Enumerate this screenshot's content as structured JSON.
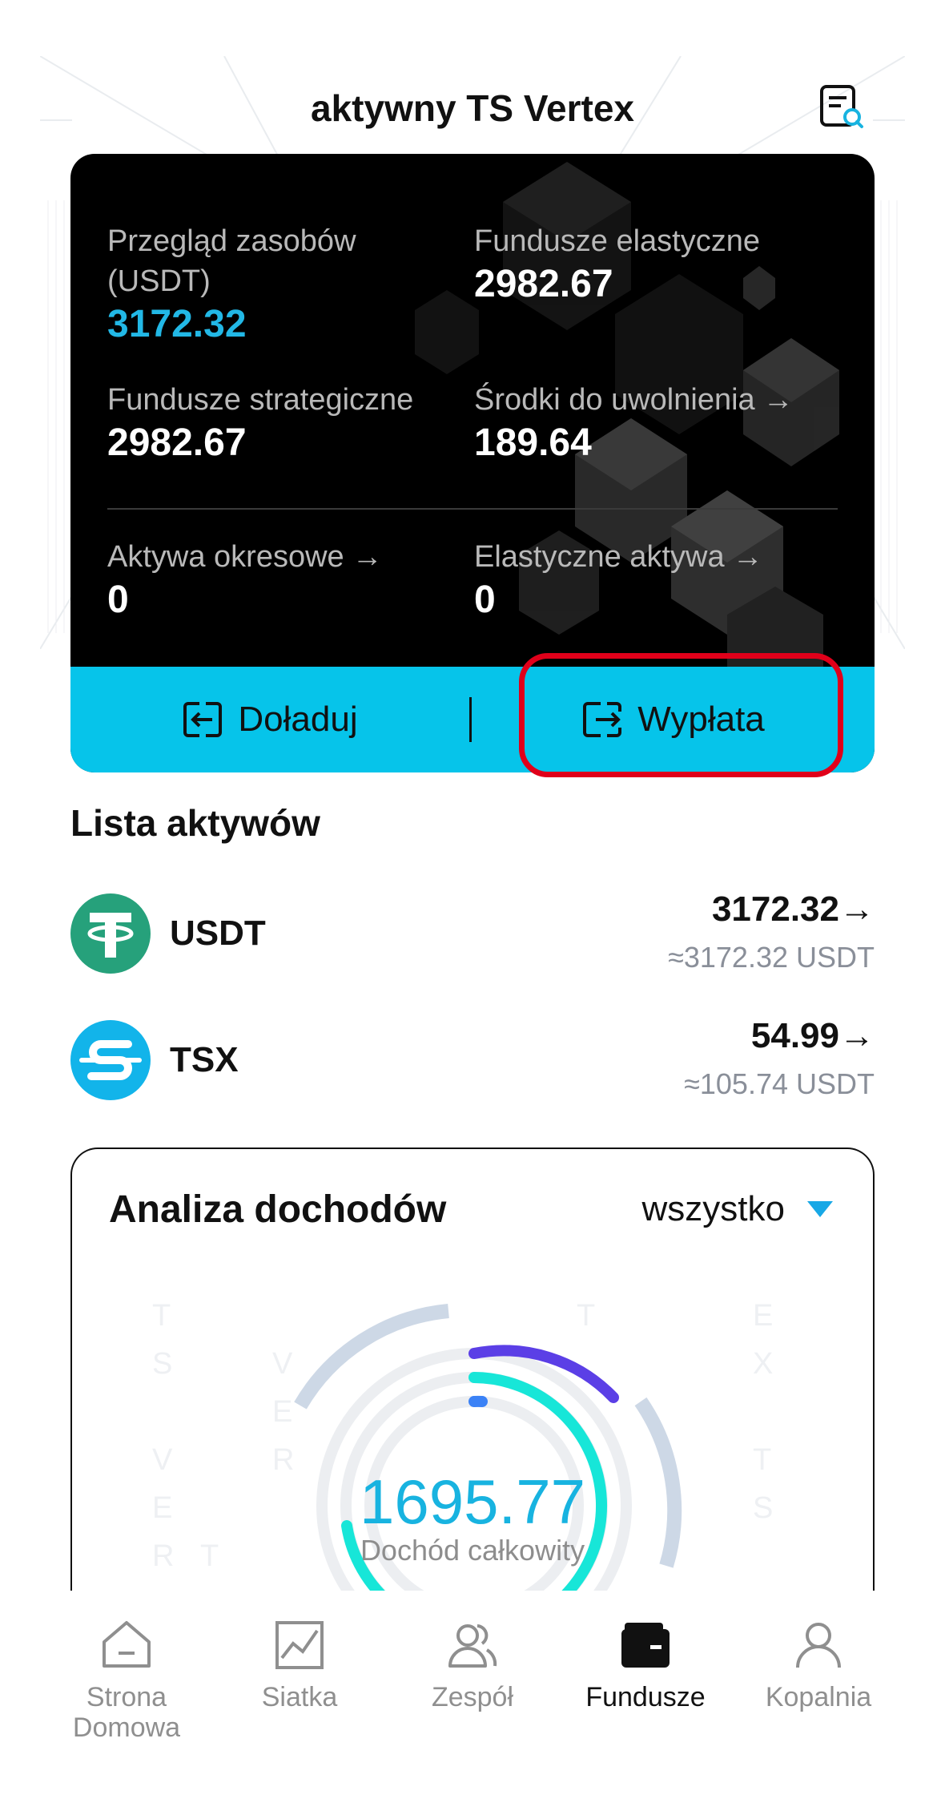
{
  "header": {
    "title": "aktywny TS Vertex",
    "records_icon": "document-search-icon"
  },
  "overview": {
    "total": {
      "label": "Przegląd zasobów (USDT)",
      "value": "3172.32"
    },
    "flexible": {
      "label": "Fundusze elastyczne",
      "value": "2982.67"
    },
    "strategic": {
      "label": "Fundusze strategiczne",
      "value": "2982.67"
    },
    "releasable": {
      "label": "Środki do uwolnienia",
      "value": "189.64"
    },
    "periodic": {
      "label": "Aktywa okresowe",
      "value": "0"
    },
    "flexible_assets": {
      "label": "Elastyczne aktywa",
      "value": "0"
    },
    "arrow_glyph": "→",
    "accent_color": "#22b8e6"
  },
  "actions": {
    "deposit": {
      "label": "Doładuj",
      "icon": "deposit-icon"
    },
    "withdraw": {
      "label": "Wypłata",
      "icon": "withdraw-icon"
    },
    "bar_color": "#06c4ea",
    "highlight_color": "#e0001a"
  },
  "asset_list": {
    "title": "Lista aktywów",
    "items": [
      {
        "name": "USDT",
        "amount": "3172.32→",
        "approx": "≈3172.32 USDT",
        "icon": "tether-icon",
        "color": "#26a17b"
      },
      {
        "name": "TSX",
        "amount": "54.99→",
        "approx": "≈105.74 USDT",
        "icon": "tsx-coin-icon",
        "color": "#12b4ea"
      }
    ]
  },
  "income": {
    "title": "Analiza dochodów",
    "filter": "wszystko",
    "total": "1695.77",
    "caption": "Dochód całkowity"
  },
  "nav": {
    "items": [
      {
        "label": "Strona Domowa",
        "icon": "home-icon",
        "active": false
      },
      {
        "label": "Siatka",
        "icon": "chart-grid-icon",
        "active": false
      },
      {
        "label": "Zespół",
        "icon": "team-icon",
        "active": false
      },
      {
        "label": "Fundusze",
        "icon": "wallet-icon",
        "active": true
      },
      {
        "label": "Kopalnia",
        "icon": "miner-icon",
        "active": false
      }
    ]
  }
}
